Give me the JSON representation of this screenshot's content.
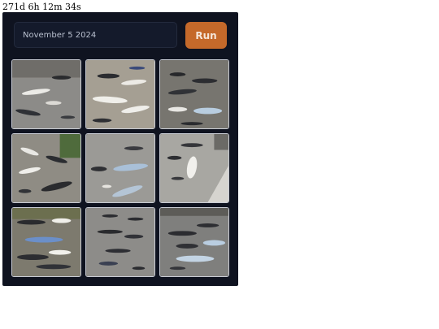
{
  "timer": {
    "text": "271d 6h 12m 34s"
  },
  "prompt": {
    "value": "November 5 2024"
  },
  "toolbar": {
    "run_label": "Run"
  },
  "colors": {
    "panel_bg": "#0f1320",
    "run_button": "#c5692a"
  },
  "gallery": {
    "image_count": 9
  }
}
